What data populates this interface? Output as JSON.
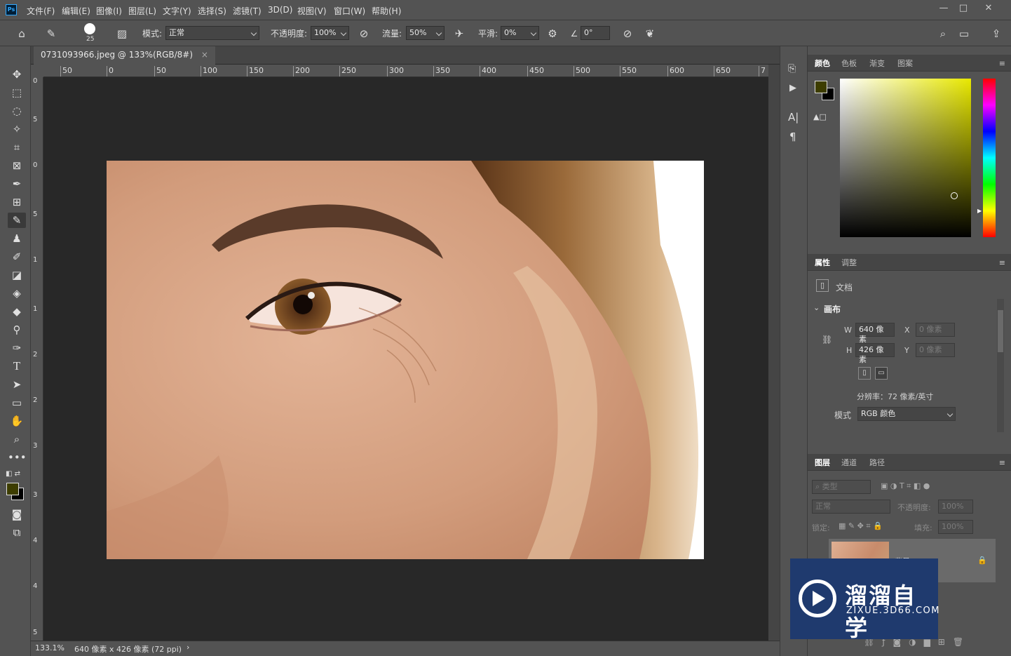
{
  "app": {
    "logo": "Ps"
  },
  "menu": [
    "文件(F)",
    "编辑(E)",
    "图像(I)",
    "图层(L)",
    "文字(Y)",
    "选择(S)",
    "滤镜(T)",
    "3D(D)",
    "视图(V)",
    "窗口(W)",
    "帮助(H)"
  ],
  "options": {
    "brush_size": "25",
    "mode_label": "模式:",
    "mode_value": "正常",
    "opacity_label": "不透明度:",
    "opacity_value": "100%",
    "flow_label": "流量:",
    "flow_value": "50%",
    "smooth_label": "平滑:",
    "smooth_value": "0%",
    "angle_value": "0°"
  },
  "document": {
    "tab_title": "0731093966.jpeg @ 133%(RGB/8#)",
    "tab_close": "×"
  },
  "ruler": {
    "h_ticks": [
      "50",
      "0",
      "50",
      "100",
      "150",
      "200",
      "250",
      "300",
      "350",
      "400",
      "450",
      "500",
      "550",
      "600",
      "650",
      "7"
    ],
    "v_ticks": [
      "0",
      "5",
      "0",
      "5",
      "1",
      "1",
      "2",
      "2",
      "3",
      "3",
      "4",
      "4",
      "5"
    ]
  },
  "status": {
    "zoom": "133.1%",
    "info": "640 像素 x 426 像素 (72 ppi)",
    "arrow": "›"
  },
  "color_panel": {
    "tabs": [
      "颜色",
      "色板",
      "渐变",
      "图案"
    ],
    "foreground": "#3d3d00",
    "background": "#000000",
    "hue_color": "#e8e800"
  },
  "properties_panel": {
    "tabs": [
      "属性",
      "调整"
    ],
    "doc_label": "文档",
    "section": "画布",
    "w_label": "W",
    "w_value": "640 像素",
    "h_label": "H",
    "h_value": "426 像素",
    "x_label": "X",
    "x_value": "0 像素",
    "y_label": "Y",
    "y_value": "0 像素",
    "resolution": "分辨率：72 像素/英寸",
    "mode_label": "模式",
    "mode_value": "RGB 颜色"
  },
  "layers_panel": {
    "tabs": [
      "图层",
      "通道",
      "路径"
    ],
    "filter_placeholder": "类型",
    "blend_mode": "正常",
    "opacity_label": "不透明度:",
    "opacity_value": "100%",
    "lock_label": "锁定:",
    "fill_label": "填充:",
    "fill_value": "100%",
    "layer_name": "背景"
  },
  "watermark": {
    "title": "溜溜自学",
    "url": "ZIXUE.3D66.COM"
  }
}
